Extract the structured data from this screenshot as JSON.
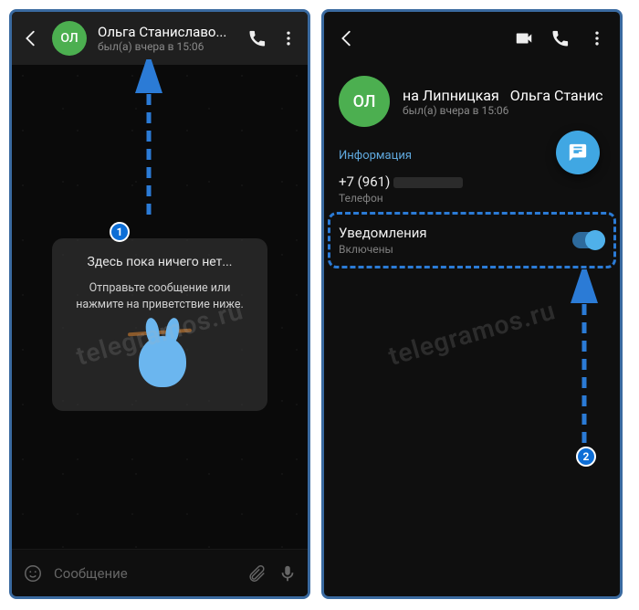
{
  "left": {
    "avatar_initials": "ОЛ",
    "chat_name": "Ольга Станиславо...",
    "last_seen": "был(а) вчера в 15:06",
    "empty_title": "Здесь пока ничего нет...",
    "empty_text": "Отправьте сообщение или нажмите на приветствие ниже.",
    "input_placeholder": "Сообщение"
  },
  "right": {
    "avatar_initials": "ОЛ",
    "name_part1": "на Липницкая",
    "name_part2": "Ольга Станис",
    "last_seen": "был(а) вчера в 15:06",
    "section_info": "Информация",
    "phone_prefix": "+7 (961)",
    "phone_label": "Телефон",
    "notifications_title": "Уведомления",
    "notifications_state": "Включены"
  },
  "annotations": {
    "badge1": "1",
    "badge2": "2"
  },
  "watermark": "telegramos.ru"
}
